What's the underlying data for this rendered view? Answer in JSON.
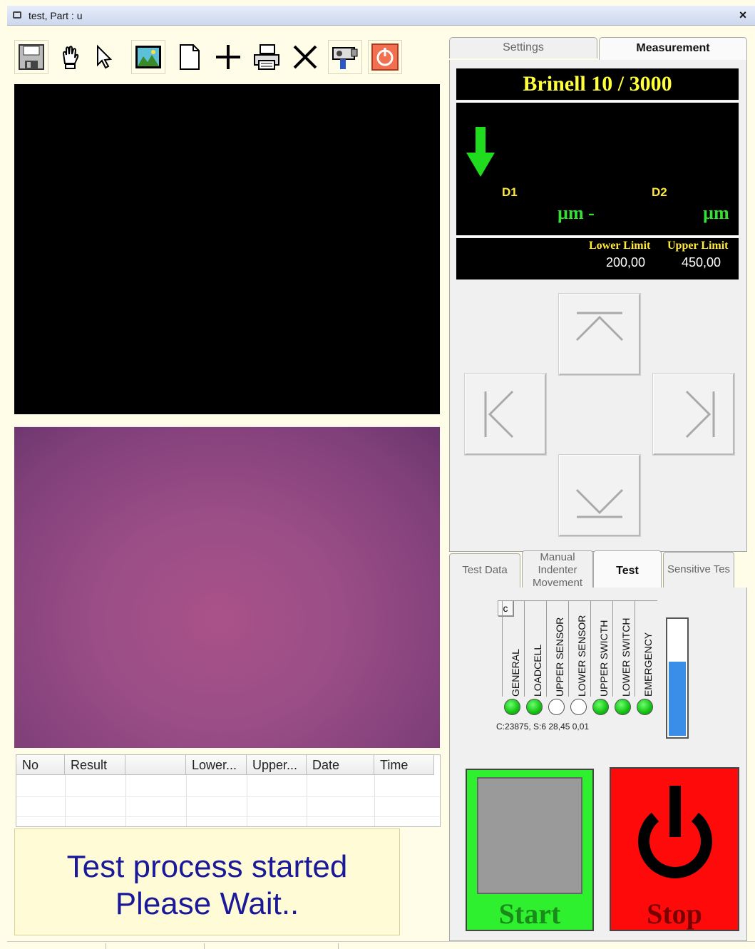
{
  "window": {
    "title": "test, Part : u",
    "close": "×"
  },
  "toolbar": {
    "icons": [
      "save-icon",
      "hand-icon",
      "pointer-icon",
      "image-icon",
      "new-document-icon",
      "crosshair-icon",
      "print-icon",
      "delete-icon",
      "camera-icon",
      "power-icon"
    ]
  },
  "right_tabs": {
    "settings": "Settings",
    "measurement": "Measurement"
  },
  "measurement": {
    "title": "Brinell 10 / 3000",
    "d1_label": "D1",
    "d2_label": "D2",
    "d1_unit": "µm -",
    "d2_unit": "µm",
    "lower_limit_label": "Lower Limit",
    "upper_limit_label": "Upper Limit",
    "lower_limit_value": "200,00",
    "upper_limit_value": "450,00",
    "indicator_color": "#1fdc1f"
  },
  "lower_tabs": {
    "test_data": "Test Data",
    "manual_line1": "Manual",
    "manual_line2": "Indenter",
    "manual_line3": "Movement",
    "test": "Test",
    "sensitive": "Sensitive Tes"
  },
  "sensors": {
    "clear_button": "c",
    "labels": [
      "GENERAL",
      "LOADCELL",
      "UPPER SENSOR",
      "LOWER SENSOR",
      "UPPER SWICTH",
      "LOWER SWITCH",
      "EMERGENCY"
    ],
    "states": [
      "on",
      "on",
      "off",
      "off",
      "on",
      "on",
      "on"
    ],
    "counter_text": "C:23875, S:6 28,45 0,01",
    "gauge_level": 0.65
  },
  "results_table": {
    "columns": [
      "No",
      "Result",
      "",
      "Lower...",
      "Upper...",
      "Date",
      "Time"
    ]
  },
  "status": {
    "line1": "Test process started",
    "line2": "Please Wait.."
  },
  "buttons": {
    "start": "Start",
    "stop": "Stop"
  }
}
